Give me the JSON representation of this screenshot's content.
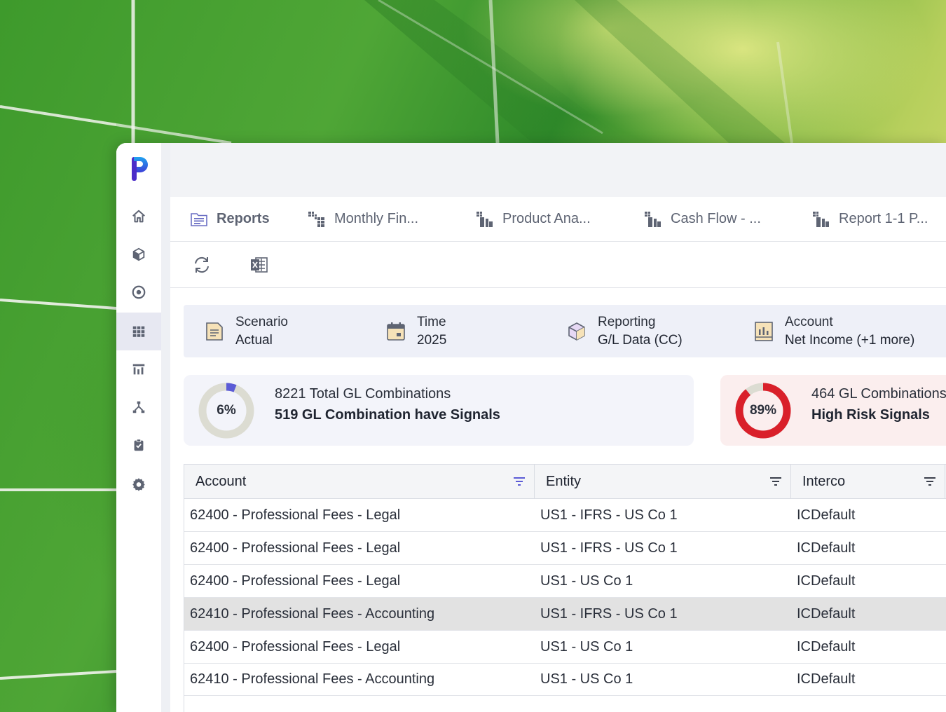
{
  "tabs": [
    {
      "label": "Reports",
      "icon": "report-folder-icon"
    },
    {
      "label": "Monthly Fin...",
      "icon": "grid-report-icon"
    },
    {
      "label": "Product Ana...",
      "icon": "grid-report-icon"
    },
    {
      "label": "Cash Flow - ...",
      "icon": "grid-report-icon"
    },
    {
      "label": "Report 1-1 P...",
      "icon": "grid-report-icon"
    }
  ],
  "toolbar": {
    "refresh_icon": "refresh-icon",
    "excel_icon": "excel-export-icon"
  },
  "filters": [
    {
      "label": "Scenario",
      "value": "Actual",
      "icon": "document-icon"
    },
    {
      "label": "Time",
      "value": "2025",
      "icon": "calendar-icon"
    },
    {
      "label": "Reporting",
      "value": "G/L Data (CC)",
      "icon": "cube-icon"
    },
    {
      "label": "Account",
      "value": "Net Income (+1 more)",
      "icon": "ledger-icon"
    }
  ],
  "cards": {
    "gl": {
      "percent": "6%",
      "fraction": 0.06,
      "line1": "8221 Total GL Combinations",
      "line2": "519 GL Combination have Signals"
    },
    "risk": {
      "percent": "89%",
      "fraction": 0.89,
      "line1": "464 GL Combinations",
      "line2": "High Risk Signals"
    }
  },
  "table": {
    "columns": [
      "Account",
      "Entity",
      "Interco"
    ],
    "rows": [
      [
        "62400 - Professional Fees - Legal",
        "US1 - IFRS - US Co 1",
        "ICDefault"
      ],
      [
        "62400 - Professional Fees - Legal",
        "US1 - IFRS - US Co 1",
        "ICDefault"
      ],
      [
        "62400 - Professional Fees - Legal",
        "US1 - US Co 1",
        "ICDefault"
      ],
      [
        "62410 - Professional Fees - Accounting",
        "US1 - IFRS - US Co 1",
        "ICDefault"
      ],
      [
        "62400 - Professional Fees - Legal",
        "US1 - US Co 1",
        "ICDefault"
      ],
      [
        "62410 - Professional Fees - Accounting",
        "US1 - US Co 1",
        "ICDefault"
      ]
    ],
    "selected_row": 3
  },
  "sidebar": {
    "items": [
      "home-icon",
      "cube-icon",
      "target-icon",
      "grid-icon",
      "report-chart-icon",
      "hierarchy-icon",
      "clipboard-check-icon",
      "gear-icon"
    ],
    "active": 3
  },
  "colors": {
    "accent": "#5b5bd6",
    "danger": "#d9202a",
    "track": "#dcdcd2"
  }
}
